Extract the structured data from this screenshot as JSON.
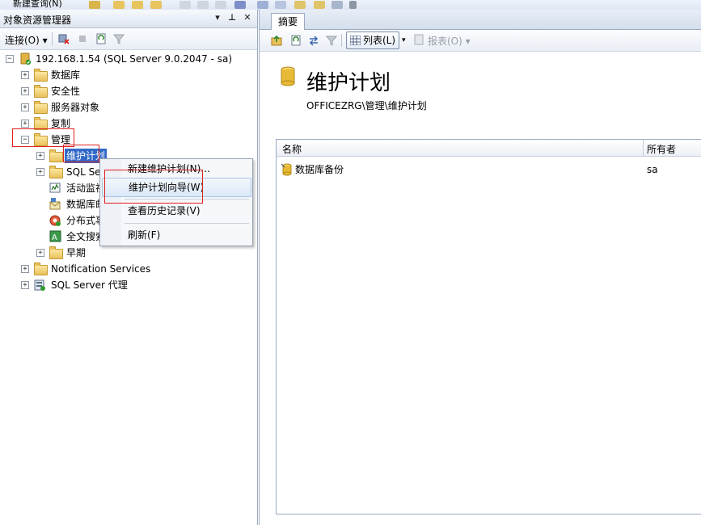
{
  "top_toolbar": {
    "new_query": "新建查询(N)"
  },
  "object_explorer": {
    "title": "对象资源管理器",
    "pin_glyph": "▾",
    "dock_glyph": "ꟷ",
    "close_glyph": "✕",
    "connect_label": "连接(O)",
    "server_node": "192.168.1.54 (SQL Server 9.0.2047 - sa)",
    "nodes": {
      "databases": "数据库",
      "security": "安全性",
      "server_objects": "服务器对象",
      "replication": "复制",
      "management": "管理",
      "maintenance_plans": "维护计划",
      "sql_server_logs": "SQL Se",
      "activity_monitor": "活动监视",
      "database_mail": "数据库邮",
      "dtc": "分布式事",
      "fulltext_search": "全文搜索",
      "legacy": "早期",
      "notification_services": "Notification Services",
      "sql_agent": "SQL Server 代理"
    }
  },
  "context_menu": {
    "items": [
      "新建维护计划(N)...",
      "维护计划向导(W)",
      "查看历史记录(V)",
      "刷新(F)"
    ]
  },
  "summary": {
    "tab": "摘要",
    "list_button": "列表(L)",
    "report_button": "报表(O)",
    "title": "维护计划",
    "breadcrumb": "OFFICEZRG\\管理\\维护计划",
    "columns": [
      "名称",
      "所有者"
    ],
    "rows": [
      {
        "name": "数据库备份",
        "owner": "sa"
      }
    ]
  }
}
